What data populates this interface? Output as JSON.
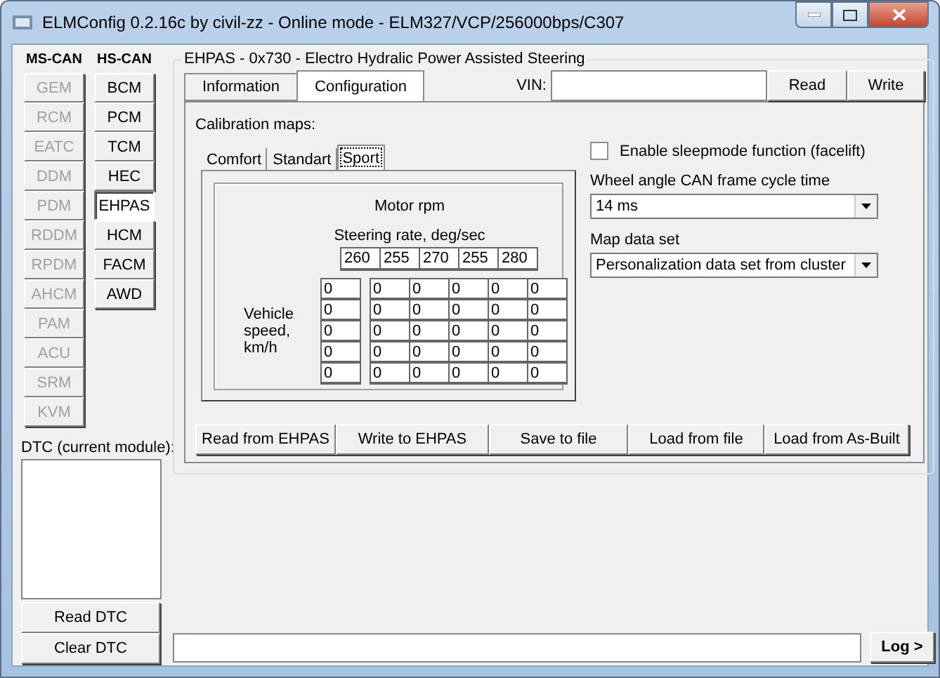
{
  "window": {
    "title": "ELMConfig 0.2.16c by civil-zz - Online mode - ELM327/VCP/256000bps/C307"
  },
  "modules": [
    {
      "title": "MS-CAN",
      "items": [
        {
          "label": "GEM",
          "disabled": true,
          "selected": false
        },
        {
          "label": "RCM",
          "disabled": true,
          "selected": false
        },
        {
          "label": "EATC",
          "disabled": true,
          "selected": false
        },
        {
          "label": "DDM",
          "disabled": true,
          "selected": false
        },
        {
          "label": "PDM",
          "disabled": true,
          "selected": false
        },
        {
          "label": "RDDM",
          "disabled": true,
          "selected": false
        },
        {
          "label": "RPDM",
          "disabled": true,
          "selected": false
        },
        {
          "label": "AHCM",
          "disabled": true,
          "selected": false
        },
        {
          "label": "PAM",
          "disabled": true,
          "selected": false
        },
        {
          "label": "ACU",
          "disabled": true,
          "selected": false
        },
        {
          "label": "SRM",
          "disabled": true,
          "selected": false
        },
        {
          "label": "KVM",
          "disabled": true,
          "selected": false
        }
      ]
    },
    {
      "title": "HS-CAN",
      "items": [
        {
          "label": "BCM",
          "disabled": false,
          "selected": false
        },
        {
          "label": "PCM",
          "disabled": false,
          "selected": false
        },
        {
          "label": "TCM",
          "disabled": false,
          "selected": false
        },
        {
          "label": "HEC",
          "disabled": false,
          "selected": false
        },
        {
          "label": "EHPAS",
          "disabled": false,
          "selected": true
        },
        {
          "label": "HCM",
          "disabled": false,
          "selected": false
        },
        {
          "label": "FACM",
          "disabled": false,
          "selected": false
        },
        {
          "label": "AWD",
          "disabled": false,
          "selected": false
        }
      ]
    }
  ],
  "dtc": {
    "label": "DTC (current module):",
    "buttons": [
      "Read DTC",
      "Clear DTC"
    ]
  },
  "group": {
    "title": "EHPAS - 0x730 - Electro Hydralic Power Assisted Steering"
  },
  "tabs": [
    {
      "label": "Information",
      "selected": false
    },
    {
      "label": "Configuration",
      "selected": true
    }
  ],
  "vin": {
    "label": "VIN:",
    "buttons": [
      "Read",
      "Write"
    ]
  },
  "calibration": {
    "label": "Calibration maps:",
    "tabs": [
      {
        "label": "Comfort",
        "selected": false
      },
      {
        "label": "Standart",
        "selected": false
      },
      {
        "label": "Sport",
        "selected": true
      }
    ],
    "title": "Motor rpm",
    "rate_label": "Steering rate, deg/sec",
    "rates": [
      "260",
      "255",
      "270",
      "255",
      "280"
    ],
    "speed_label": "Vehicle speed, km/h",
    "speeds": [
      "0",
      "0",
      "0",
      "0",
      "0"
    ],
    "values": [
      [
        "0",
        "0",
        "0",
        "0",
        "0"
      ],
      [
        "0",
        "0",
        "0",
        "0",
        "0"
      ],
      [
        "0",
        "0",
        "0",
        "0",
        "0"
      ],
      [
        "0",
        "0",
        "0",
        "0",
        "0"
      ],
      [
        "0",
        "0",
        "0",
        "0",
        "0"
      ]
    ]
  },
  "settings": {
    "sleepmode": {
      "label": "Enable sleepmode function (facelift)",
      "checked": false
    },
    "cycle_time": {
      "label": "Wheel angle CAN frame cycle time",
      "value": "14 ms"
    },
    "map_data_set": {
      "label": "Map data set",
      "value": "Personalization data set from cluster"
    }
  },
  "actions": [
    "Read from EHPAS",
    "Write to EHPAS",
    "Save to file",
    "Load from file",
    "Load from As-Built"
  ],
  "log": {
    "button": "Log >"
  }
}
